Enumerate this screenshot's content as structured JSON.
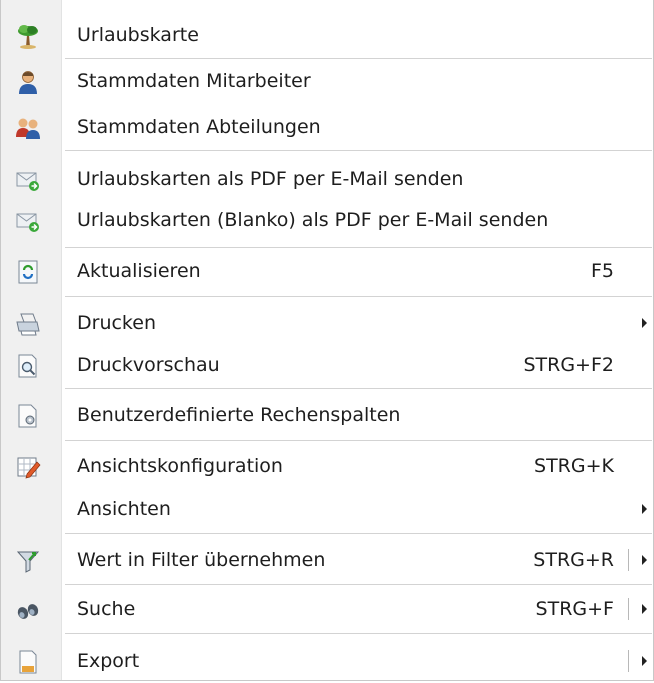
{
  "menu": {
    "items": [
      {
        "label": "Urlaubskarte",
        "icon": "palm-tree-icon"
      },
      {
        "label": "Stammdaten Mitarbeiter",
        "icon": "user-icon"
      },
      {
        "label": "Stammdaten Abteilungen",
        "icon": "users-group-icon"
      },
      {
        "label": "Urlaubskarten als PDF per E-Mail senden",
        "icon": "mail-send-icon"
      },
      {
        "label": "Urlaubskarten (Blanko) als PDF per E-Mail senden",
        "icon": "mail-send-icon"
      },
      {
        "label": "Aktualisieren",
        "shortcut": "F5",
        "icon": "refresh-icon"
      },
      {
        "label": "Drucken",
        "icon": "printer-icon",
        "submenu": true
      },
      {
        "label": "Druckvorschau",
        "shortcut": "STRG+F2",
        "icon": "print-preview-icon"
      },
      {
        "label": "Benutzerdefinierte Rechenspalten",
        "icon": "document-gear-icon"
      },
      {
        "label": "Ansichtskonfiguration",
        "shortcut": "STRG+K",
        "icon": "table-edit-icon"
      },
      {
        "label": "Ansichten",
        "submenu": true
      },
      {
        "label": "Wert in Filter übernehmen",
        "shortcut": "STRG+R",
        "icon": "filter-icon",
        "submenu": true
      },
      {
        "label": "Suche",
        "shortcut": "STRG+F",
        "icon": "binoculars-icon",
        "submenu": true
      },
      {
        "label": "Export",
        "icon": "export-icon",
        "submenu": true
      }
    ]
  }
}
